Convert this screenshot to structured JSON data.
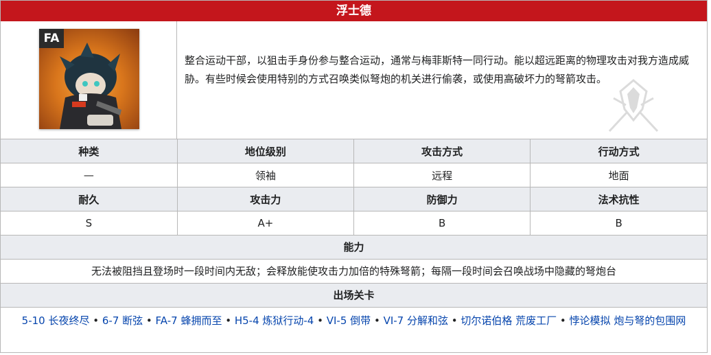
{
  "title": "浮士德",
  "badge": "FA",
  "description": "整合运动干部，以狙击手身份参与整合运动，通常与梅菲斯特一同行动。能以超远距离的物理攻击对我方造成威胁。有些时候会使用特别的方式召唤类似弩炮的机关进行偷袭，或使用高破坏力的弩箭攻击。",
  "stats_row1": {
    "headers": [
      "种类",
      "地位级别",
      "攻击方式",
      "行动方式"
    ],
    "values": [
      "—",
      "领袖",
      "远程",
      "地面"
    ]
  },
  "stats_row2": {
    "headers": [
      "耐久",
      "攻击力",
      "防御力",
      "法术抗性"
    ],
    "values": [
      "S",
      "A+",
      "B",
      "B"
    ]
  },
  "ability": {
    "header": "能力",
    "text": "无法被阻挡且登场时一段时间内无敌；会释放能使攻击力加倍的特殊弩箭；每隔一段时间会召唤战场中隐藏的弩炮台"
  },
  "stages": {
    "header": "出场关卡",
    "separator": " • ",
    "items": [
      "5-10 长夜终尽",
      "6-7 断弦",
      "FA-7 蜂拥而至",
      "H5-4 炼狱行动-4",
      "VI-5 倒带",
      "VI-7 分解和弦",
      "切尔诺伯格 荒废工厂",
      "悖论模拟 炮与弩的包围网"
    ]
  },
  "colors": {
    "header_red": "#c4161c",
    "link_blue": "#0645ad",
    "header_gray": "#eaecf0"
  }
}
